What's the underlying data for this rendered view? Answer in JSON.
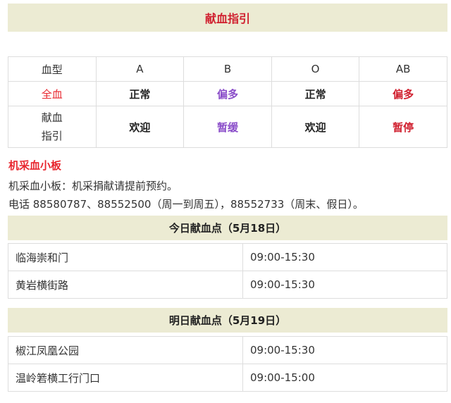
{
  "header": {
    "title": "献血指引"
  },
  "blood_table": {
    "header_label": "血型",
    "types": [
      "A",
      "B",
      "O",
      "AB"
    ],
    "whole_blood_label": "全血",
    "whole_blood": [
      "正常",
      "偏多",
      "正常",
      "偏多"
    ],
    "guide_label_line1": "献血",
    "guide_label_line2": "指引",
    "guide": [
      "欢迎",
      "暂缓",
      "欢迎",
      "暂停"
    ],
    "colors": {
      "normal": "#222222",
      "purple": "#8a4dc9",
      "red": "#d0202f",
      "label_red": "#e8262e"
    }
  },
  "platelet": {
    "title": "机采血小板",
    "line1": "机采血小板：机采捐献请提前预约。",
    "line2": "电话 88580787、88552500（周一到周五），88552733（周末、假日）。"
  },
  "today": {
    "heading": "今日献血点（5月18日）",
    "rows": [
      {
        "place": "临海崇和门",
        "time": "09:00-15:30"
      },
      {
        "place": "黄岩横街路",
        "time": "09:00-15:30"
      }
    ]
  },
  "tomorrow": {
    "heading": "明日献血点（5月19日）",
    "rows": [
      {
        "place": "椒江凤凰公园",
        "time": "09:00-15:30"
      },
      {
        "place": "温岭箬横工行门口",
        "time": "09:00-15:00"
      }
    ]
  }
}
